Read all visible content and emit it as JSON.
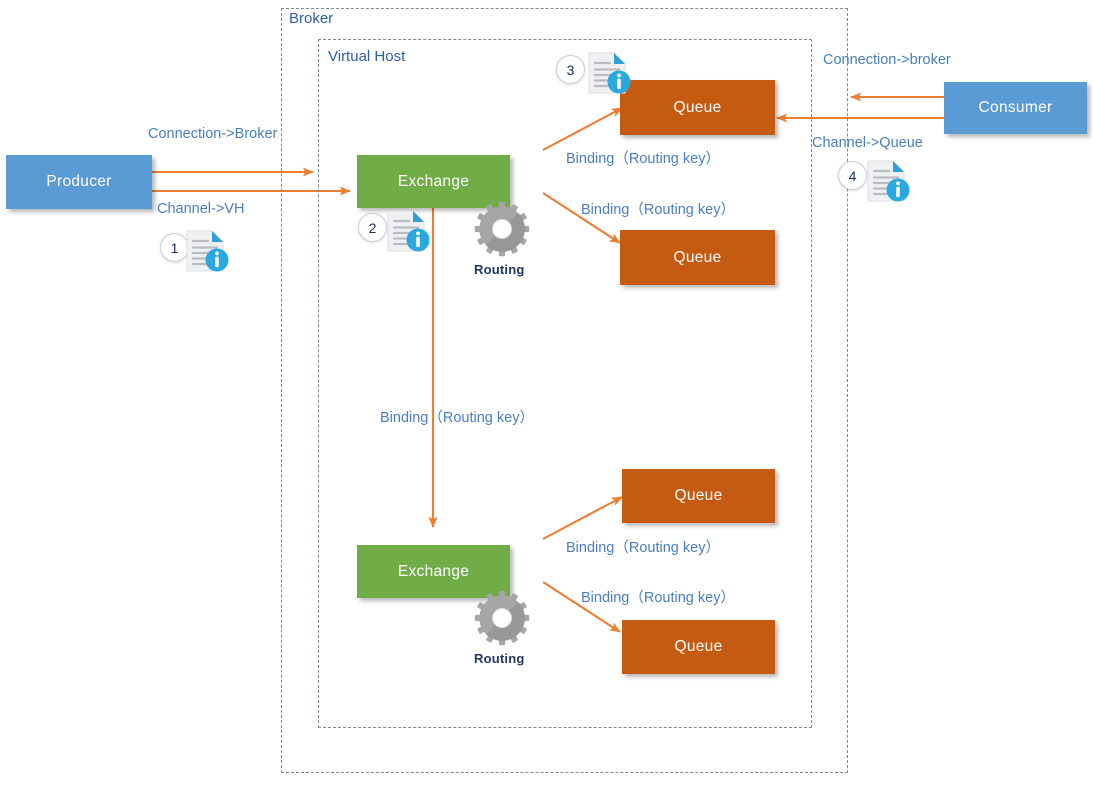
{
  "diagram": {
    "title": "RabbitMQ message flow diagram",
    "colors": {
      "producer_consumer": "#5b9bd5",
      "exchange": "#70ad47",
      "queue": "#c55a11",
      "arrow": "#ed7d31",
      "label_text": "#4a7ebb",
      "dark_text": "#1f3864",
      "boundary": "#7f8792"
    }
  },
  "boundaries": {
    "broker": {
      "label": "Broker"
    },
    "virtual_host": {
      "label": "Virtual Host"
    }
  },
  "nodes": {
    "producer": {
      "label": "Producer"
    },
    "consumer": {
      "label": "Consumer"
    },
    "exchange_top": {
      "label": "Exchange"
    },
    "exchange_bottom": {
      "label": "Exchange"
    },
    "queue_1": {
      "label": "Queue"
    },
    "queue_2": {
      "label": "Queue"
    },
    "queue_3": {
      "label": "Queue"
    },
    "queue_4": {
      "label": "Queue"
    }
  },
  "edge_labels": {
    "producer_connection": "Connection->Broker",
    "producer_channel": "Channel->VH",
    "consumer_connection": "Connection->broker",
    "consumer_channel": "Channel->Queue",
    "binding_1": "Binding（Routing key）",
    "binding_2": "Binding（Routing key）",
    "binding_3": "Binding（Routing key）",
    "binding_4": "Binding（Routing key）",
    "binding_5": "Binding（Routing key）"
  },
  "annotations": {
    "routing_top": "Routing",
    "routing_bottom": "Routing",
    "step_1": "1",
    "step_2": "2",
    "step_3": "3",
    "step_4": "4"
  }
}
